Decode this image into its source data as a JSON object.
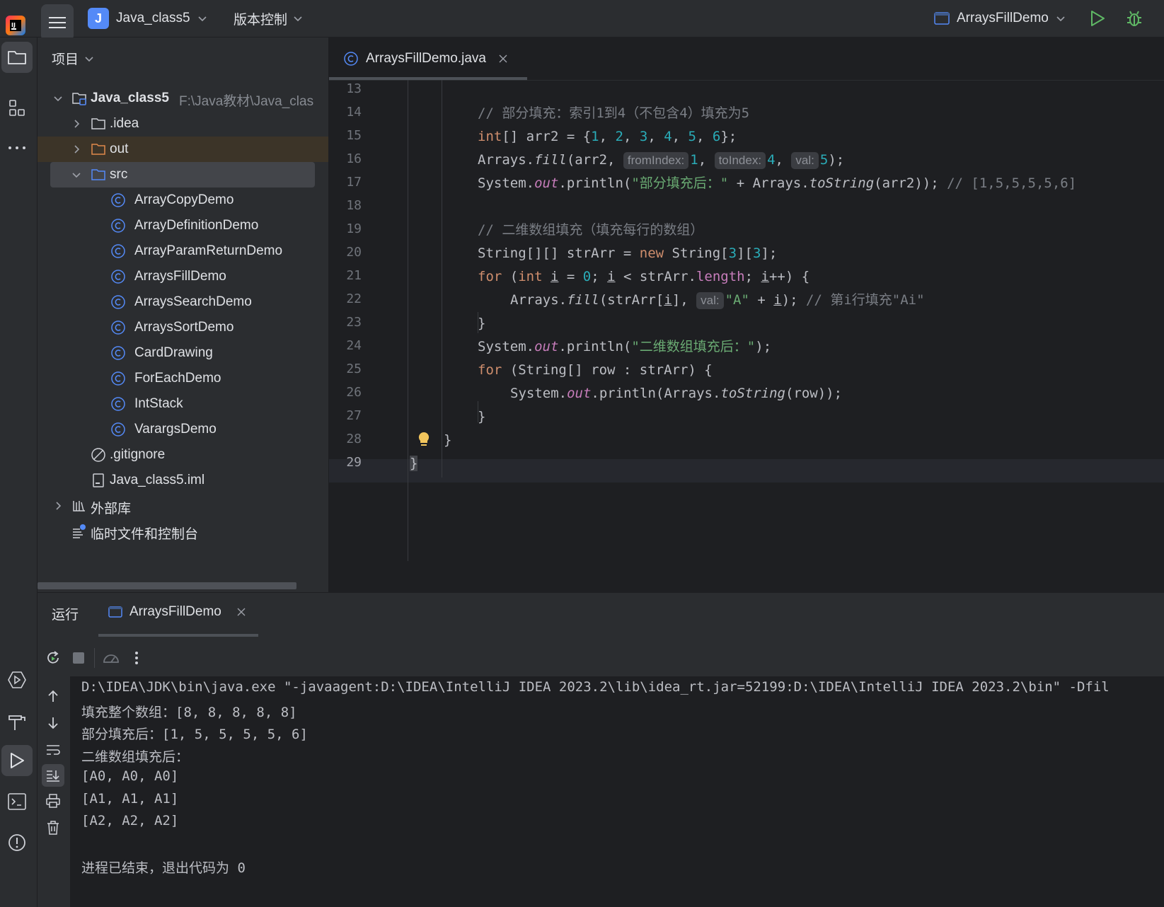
{
  "topbar": {
    "project_initial": "J",
    "project_name": "Java_class5",
    "vcs_label": "版本控制",
    "run_config": "ArraysFillDemo"
  },
  "project_panel": {
    "title": "项目",
    "tree": [
      {
        "label": "Java_class5",
        "path": "F:\\Java教材\\Java_clas",
        "type": "module"
      },
      {
        "label": ".idea",
        "type": "folder"
      },
      {
        "label": "out",
        "type": "folder"
      },
      {
        "label": "src",
        "type": "folder"
      },
      {
        "label": "ArrayCopyDemo",
        "type": "class"
      },
      {
        "label": "ArrayDefinitionDemo",
        "type": "class"
      },
      {
        "label": "ArrayParamReturnDemo",
        "type": "class"
      },
      {
        "label": "ArraysFillDemo",
        "type": "class"
      },
      {
        "label": "ArraysSearchDemo",
        "type": "class"
      },
      {
        "label": "ArraysSortDemo",
        "type": "class"
      },
      {
        "label": "CardDrawing",
        "type": "class"
      },
      {
        "label": "ForEachDemo",
        "type": "class"
      },
      {
        "label": "IntStack",
        "type": "class"
      },
      {
        "label": "VarargsDemo",
        "type": "class"
      },
      {
        "label": ".gitignore",
        "type": "ignore"
      },
      {
        "label": "Java_class5.iml",
        "type": "iml"
      },
      {
        "label": "外部库",
        "type": "libraries"
      },
      {
        "label": "临时文件和控制台",
        "type": "scratches"
      }
    ]
  },
  "editor": {
    "tab_label": "ArraysFillDemo.java",
    "line_numbers": [
      "13",
      "14",
      "15",
      "16",
      "17",
      "18",
      "19",
      "20",
      "21",
      "22",
      "23",
      "24",
      "25",
      "26",
      "27",
      "28",
      "29"
    ],
    "current_line": "29",
    "code": {
      "l14_comment": "// 部分填充：索引1到4（不包含4）填充为5",
      "l15_type": "int",
      "l15_rest": "[] arr2 = {",
      "l15_n1": "1",
      "l15_n2": "2",
      "l15_n3": "3",
      "l15_n4": "4",
      "l15_n5": "5",
      "l15_n6": "6",
      "l15_end": "};",
      "l16_a": "Arrays.",
      "l16_fill": "fill",
      "l16_b": "(arr2, ",
      "l16_hint1": "fromIndex:",
      "l16_v1": "1",
      "l16_hint2": "toIndex:",
      "l16_v2": "4",
      "l16_hint3": "val:",
      "l16_v3": "5",
      "l16_end": ");",
      "l17_a": "System.",
      "l17_out": "out",
      "l17_b": ".println(",
      "l17_str": "\"部分填充后：\"",
      "l17_c": " + Arrays.",
      "l17_tostring": "toString",
      "l17_d": "(arr2)); ",
      "l17_comment": "// [1,5,5,5,5,6]",
      "l19_comment": "// 二维数组填充（填充每行的数组）",
      "l20_a": "String[][] strArr = ",
      "l20_new": "new",
      "l20_b": " String[",
      "l20_n1": "3",
      "l20_c": "][",
      "l20_n2": "3",
      "l20_d": "];",
      "l21_for": "for",
      "l21_a": " (",
      "l21_int": "int",
      "l21_i1": "i",
      "l21_b": " = ",
      "l21_zero": "0",
      "l21_c": "; ",
      "l21_i2": "i",
      "l21_d": " < strArr.",
      "l21_length": "length",
      "l21_e": "; ",
      "l21_i3": "i",
      "l21_f": "++) {",
      "l22_a": "Arrays.",
      "l22_fill": "fill",
      "l22_b": "(strArr[",
      "l22_i": "i",
      "l22_c": "], ",
      "l22_hint": "val:",
      "l22_str": "\"A\"",
      "l22_d": " + ",
      "l22_i2": "i",
      "l22_e": "); ",
      "l22_comment": "// 第i行填充\"Ai\"",
      "l23": "}",
      "l24_a": "System.",
      "l24_out": "out",
      "l24_b": ".println(",
      "l24_str": "\"二维数组填充后：\"",
      "l24_c": ");",
      "l25_for": "for",
      "l25_a": " (String[] row : strArr) {",
      "l26_a": "System.",
      "l26_out": "out",
      "l26_b": ".println(Arrays.",
      "l26_tostring": "toString",
      "l26_c": "(row));",
      "l27": "}",
      "l28": "}",
      "l29": "}"
    }
  },
  "run_panel": {
    "title": "运行",
    "tab_label": "ArraysFillDemo",
    "console": [
      "D:\\IDEA\\JDK\\bin\\java.exe \"-javaagent:D:\\IDEA\\IntelliJ IDEA 2023.2\\lib\\idea_rt.jar=52199:D:\\IDEA\\IntelliJ IDEA 2023.2\\bin\" -Dfil",
      "填充整个数组：[8, 8, 8, 8, 8]",
      "部分填充后：[1, 5, 5, 5, 5, 6]",
      "二维数组填充后：",
      "[A0, A0, A0]",
      "[A1, A1, A1]",
      "[A2, A2, A2]",
      "",
      "进程已结束，退出代码为 0"
    ]
  },
  "colors": {
    "accent": "#548af7",
    "run_green": "#5fb865",
    "keyword": "#cf8e6d",
    "number": "#2aacb8",
    "string": "#6aab73",
    "comment": "#7a7e85",
    "field": "#c77dbb"
  },
  "icons": [
    "app-logo-icon",
    "hamburger-menu-icon",
    "chevron-down-icon",
    "run-config-icon",
    "run-icon",
    "debug-icon",
    "folder-icon",
    "structure-icon",
    "more-icon",
    "class-icon",
    "gitignore-icon",
    "iml-icon",
    "libraries-icon",
    "scratches-icon",
    "close-icon",
    "rerun-icon",
    "stop-icon",
    "profiler-icon",
    "arrow-up-icon",
    "arrow-down-icon",
    "soft-wrap-icon",
    "scroll-to-end-icon",
    "print-icon",
    "trash-icon",
    "services-icon",
    "build-icon",
    "terminal-icon",
    "problems-icon",
    "bulb-icon"
  ]
}
